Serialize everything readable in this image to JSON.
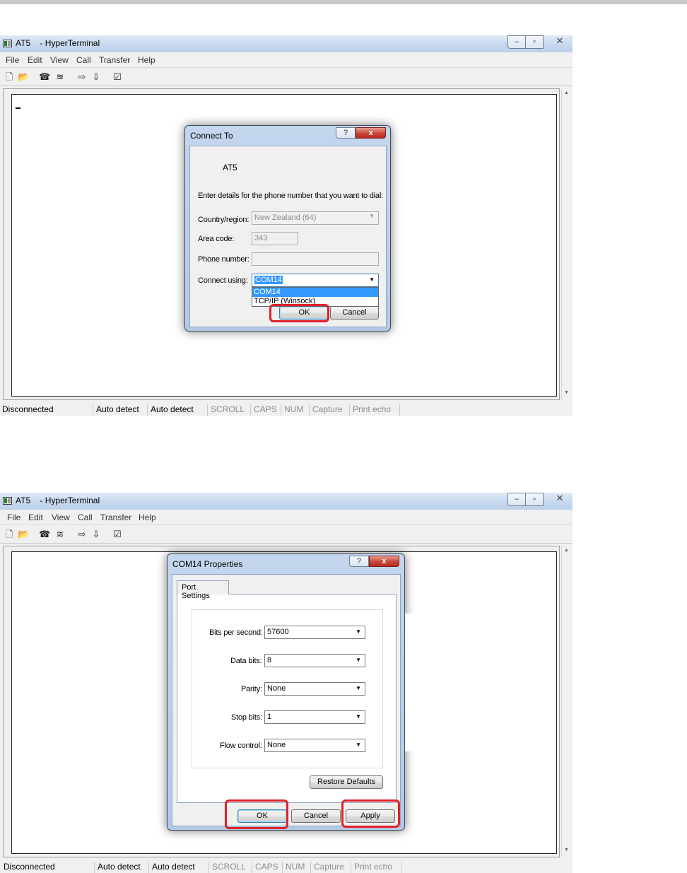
{
  "screen1": {
    "window": {
      "title": "AT5    - HyperTerminal",
      "controls": {
        "minimize": "–",
        "maximize": "▫",
        "close": "✕"
      },
      "menu": [
        "File",
        "Edit",
        "View",
        "Call",
        "Transfer",
        "Help"
      ],
      "toolbar_icons": [
        "new-icon",
        "open-icon",
        "call-icon",
        "disconnect-icon",
        "send-icon",
        "receive-icon",
        "properties-icon"
      ]
    },
    "dialog": {
      "title": "Connect To",
      "help_symbol": "?",
      "close_symbol": "x",
      "connection_name": "AT5",
      "instruction": "Enter details for the phone number that you want to dial:",
      "country_label": "Country/region:",
      "country_value": "New Zealand (64)",
      "area_label": "Area code:",
      "area_value": "343",
      "phone_label": "Phone number:",
      "phone_value": "",
      "connect_label": "Connect using:",
      "connect_value": "COM14",
      "connect_options": [
        "COM14",
        "TCP/IP (Winsock)"
      ],
      "ok_label": "OK",
      "cancel_label": "Cancel"
    },
    "status": [
      "Disconnected",
      "Auto detect",
      "Auto detect",
      "SCROLL",
      "CAPS",
      "NUM",
      "Capture",
      "Print echo"
    ]
  },
  "screen2": {
    "window": {
      "title": "AT5    - HyperTerminal",
      "controls": {
        "minimize": "–",
        "maximize": "▫",
        "close": "✕"
      },
      "menu": [
        "File",
        "Edit",
        "View",
        "Call",
        "Transfer",
        "Help"
      ]
    },
    "dialog": {
      "title": "COM14 Properties",
      "help_symbol": "?",
      "close_symbol": "x",
      "tab": "Port Settings",
      "settings": [
        {
          "label": "Bits per second:",
          "value": "57600"
        },
        {
          "label": "Data bits:",
          "value": "8"
        },
        {
          "label": "Parity:",
          "value": "None"
        },
        {
          "label": "Stop bits:",
          "value": "1"
        },
        {
          "label": "Flow control:",
          "value": "None"
        }
      ],
      "restore_label": "Restore Defaults",
      "ok_label": "OK",
      "cancel_label": "Cancel",
      "apply_label": "Apply"
    },
    "status": [
      "Disconnected",
      "Auto detect",
      "Auto detect",
      "SCROLL",
      "CAPS",
      "NUM",
      "Capture",
      "Print echo"
    ]
  },
  "colors": {
    "highlight": "#e0202a",
    "selection": "#3399ff",
    "close_button": "#c9473a"
  }
}
